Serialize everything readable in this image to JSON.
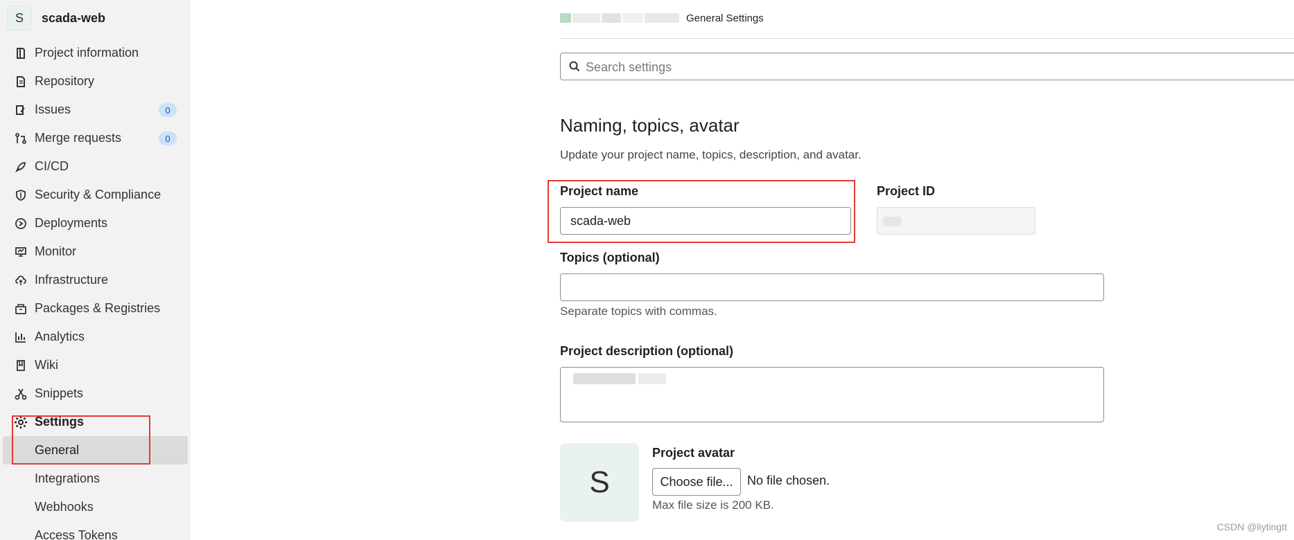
{
  "sidebar": {
    "project_initial": "S",
    "project_name": "scada-web",
    "items": [
      {
        "label": "Project information",
        "icon": "project-info-icon"
      },
      {
        "label": "Repository",
        "icon": "repository-icon"
      },
      {
        "label": "Issues",
        "icon": "issues-icon",
        "badge": "0"
      },
      {
        "label": "Merge requests",
        "icon": "merge-request-icon",
        "badge": "0"
      },
      {
        "label": "CI/CD",
        "icon": "rocket-icon"
      },
      {
        "label": "Security & Compliance",
        "icon": "shield-icon"
      },
      {
        "label": "Deployments",
        "icon": "deployments-icon"
      },
      {
        "label": "Monitor",
        "icon": "monitor-icon"
      },
      {
        "label": "Infrastructure",
        "icon": "cloud-icon"
      },
      {
        "label": "Packages & Registries",
        "icon": "package-icon"
      },
      {
        "label": "Analytics",
        "icon": "analytics-icon"
      },
      {
        "label": "Wiki",
        "icon": "book-icon"
      },
      {
        "label": "Snippets",
        "icon": "scissors-icon"
      },
      {
        "label": "Settings",
        "icon": "gear-icon"
      }
    ],
    "settings_sub": [
      {
        "label": "General"
      },
      {
        "label": "Integrations"
      },
      {
        "label": "Webhooks"
      },
      {
        "label": "Access Tokens"
      }
    ]
  },
  "breadcrumb": {
    "current": "General Settings"
  },
  "search": {
    "placeholder": "Search settings"
  },
  "section": {
    "title": "Naming, topics, avatar",
    "description": "Update your project name, topics, description, and avatar."
  },
  "form": {
    "project_name_label": "Project name",
    "project_name_value": "scada-web",
    "project_id_label": "Project ID",
    "topics_label": "Topics (optional)",
    "topics_help": "Separate topics with commas.",
    "description_label": "Project description (optional)",
    "avatar_label": "Project avatar",
    "avatar_initial": "S",
    "choose_file_label": "Choose file...",
    "no_file_text": "No file chosen.",
    "max_size_text": "Max file size is 200 KB."
  },
  "watermark": "CSDN @liytingtt",
  "colors": {
    "highlight_box": "#e53935",
    "badge_bg": "#cbe2f9",
    "sidebar_bg": "#f2f2f2"
  }
}
